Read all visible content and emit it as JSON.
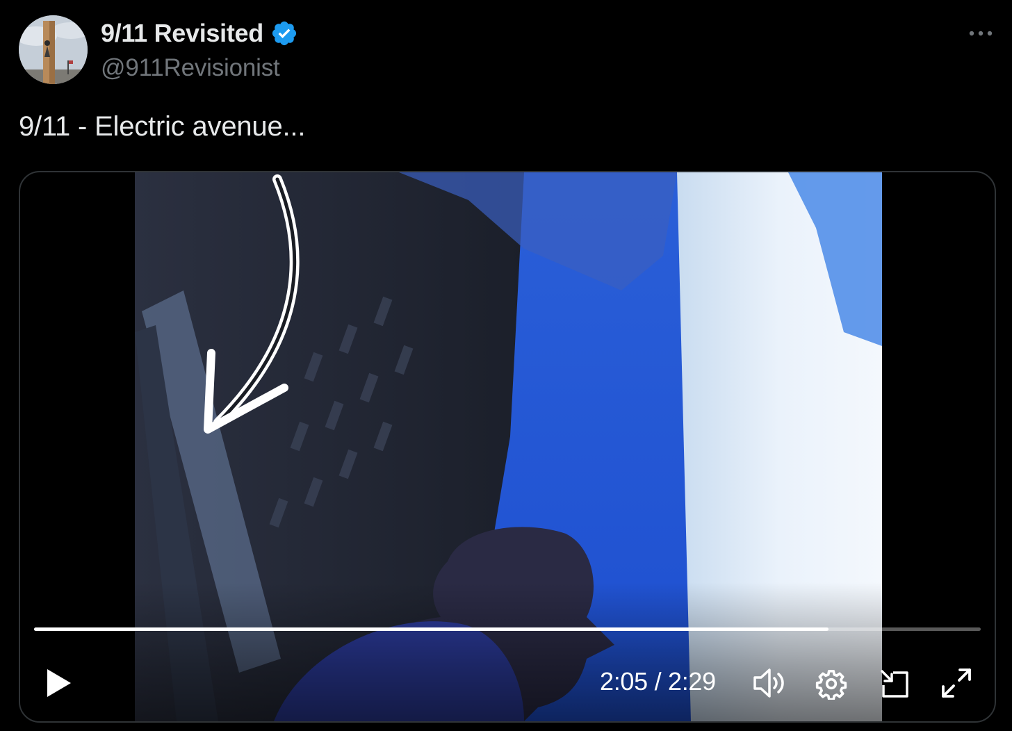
{
  "author": {
    "display_name": "9/11 Revisited",
    "handle": "@911Revisionist",
    "verified": true,
    "verified_color": "#1d9bf0"
  },
  "tweet": {
    "text": "9/11 - Electric avenue..."
  },
  "icons": {
    "more": "more-horizontal-icon",
    "play": "play-icon",
    "volume": "volume-icon",
    "settings": "gear-icon",
    "dock": "picture-in-picture-icon",
    "fullscreen": "fullscreen-icon"
  },
  "video": {
    "current_time": "2:05",
    "duration": "2:29",
    "time_display": "2:05 / 2:29",
    "progress_fraction": 0.839
  },
  "colors": {
    "background": "#000000",
    "text_primary": "#e7e9ea",
    "text_secondary": "#71767b",
    "border": "#2f3336",
    "sky_blue": "#1f5fe0"
  }
}
